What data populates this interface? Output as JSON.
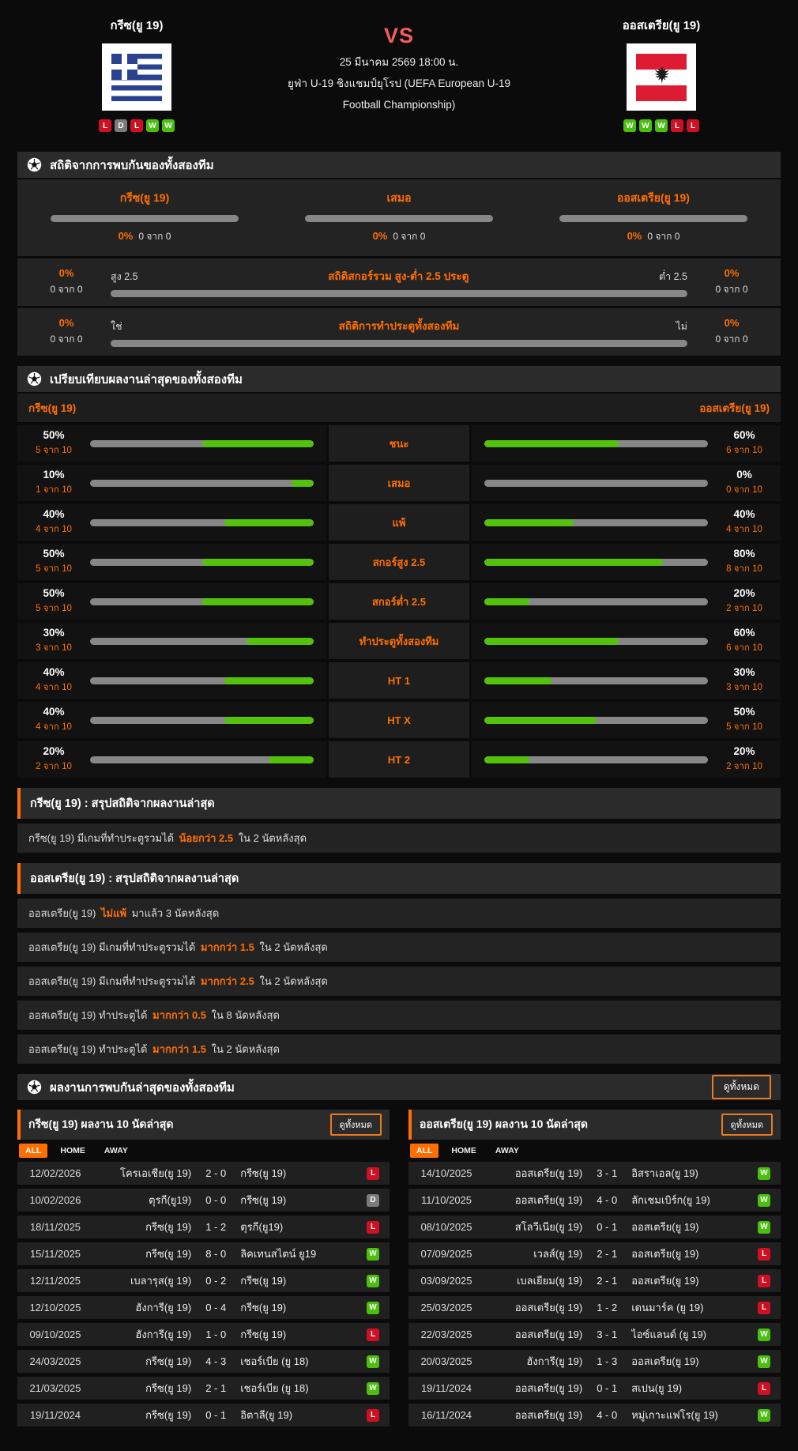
{
  "colors": {
    "accent": "#ff6f00",
    "bar_green": "#54c20d",
    "bar_gray": "#878787",
    "win": "#49c00d",
    "loss": "#d01022",
    "draw": "#7b7b7b",
    "vs_red": "#f65c5c"
  },
  "header": {
    "home_name": "กรีซ(ยู 19)",
    "away_name": "ออสเตรีย(ยู 19)",
    "vs_label": "VS",
    "kickoff": "25 มีนาคม 2569 18:00 น.",
    "competition_line1": "ยูฟ่า U-19 ชิงแชมป์ยุโรป (UEFA European U-19",
    "competition_line2": "Football Championship)",
    "home_form": [
      "L",
      "D",
      "L",
      "W",
      "W"
    ],
    "away_form": [
      "W",
      "W",
      "W",
      "L",
      "L"
    ]
  },
  "h2h": {
    "title": "สถิติจากการพบกันของทั้งสองทีม",
    "columns": [
      {
        "label": "กรีซ(ยู 19)",
        "pct_label": "0%",
        "count": "0 จาก 0",
        "pct": 0
      },
      {
        "label": "เสมอ",
        "pct_label": "0%",
        "count": "0 จาก 0",
        "pct": 0
      },
      {
        "label": "ออสเตรีย(ยู 19)",
        "pct_label": "0%",
        "count": "0 จาก 0",
        "pct": 0
      }
    ],
    "bar_rows": [
      {
        "left_pct_label": "0%",
        "left_count": "0 จาก 0",
        "bar_left_label": "สูง 2.5",
        "title": "สถิติสกอร์รวม สูง-ต่ำ 2.5 ประตู",
        "bar_right_label": "ต่ำ 2.5",
        "right_pct_label": "0%",
        "right_count": "0 จาก 0",
        "left_pct": 0,
        "right_pct": 0
      },
      {
        "left_pct_label": "0%",
        "left_count": "0 จาก 0",
        "bar_left_label": "ใช่",
        "title": "สถิติการทำประตูทั้งสองทีม",
        "bar_right_label": "ไม่",
        "right_pct_label": "0%",
        "right_count": "0 จาก 0",
        "left_pct": 0,
        "right_pct": 0
      }
    ]
  },
  "comparison": {
    "title": "เปรียบเทียบผลงานล่าสุดของทั้งสองทีม",
    "home_label": "กรีซ(ยู 19)",
    "away_label": "ออสเตรีย(ยู 19)",
    "rows": [
      {
        "label": "ชนะ",
        "home_pct": 50,
        "home_pct_label": "50%",
        "home_count": "5 จาก 10",
        "away_pct": 60,
        "away_pct_label": "60%",
        "away_count": "6 จาก 10"
      },
      {
        "label": "เสมอ",
        "home_pct": 10,
        "home_pct_label": "10%",
        "home_count": "1 จาก 10",
        "away_pct": 0,
        "away_pct_label": "0%",
        "away_count": "0 จาก 10"
      },
      {
        "label": "แพ้",
        "home_pct": 40,
        "home_pct_label": "40%",
        "home_count": "4 จาก 10",
        "away_pct": 40,
        "away_pct_label": "40%",
        "away_count": "4 จาก 10"
      },
      {
        "label": "สกอร์สูง 2.5",
        "home_pct": 50,
        "home_pct_label": "50%",
        "home_count": "5 จาก 10",
        "away_pct": 80,
        "away_pct_label": "80%",
        "away_count": "8 จาก 10"
      },
      {
        "label": "สกอร์ต่ำ 2.5",
        "home_pct": 50,
        "home_pct_label": "50%",
        "home_count": "5 จาก 10",
        "away_pct": 20,
        "away_pct_label": "20%",
        "away_count": "2 จาก 10"
      },
      {
        "label": "ทำประตูทั้งสองทีม",
        "home_pct": 30,
        "home_pct_label": "30%",
        "home_count": "3 จาก 10",
        "away_pct": 60,
        "away_pct_label": "60%",
        "away_count": "6 จาก 10"
      },
      {
        "label": "HT 1",
        "home_pct": 40,
        "home_pct_label": "40%",
        "home_count": "4 จาก 10",
        "away_pct": 30,
        "away_pct_label": "30%",
        "away_count": "3 จาก 10"
      },
      {
        "label": "HT X",
        "home_pct": 40,
        "home_pct_label": "40%",
        "home_count": "4 จาก 10",
        "away_pct": 50,
        "away_pct_label": "50%",
        "away_count": "5 จาก 10"
      },
      {
        "label": "HT 2",
        "home_pct": 20,
        "home_pct_label": "20%",
        "home_count": "2 จาก 10",
        "away_pct": 20,
        "away_pct_label": "20%",
        "away_count": "2 จาก 10"
      }
    ]
  },
  "home_summary": {
    "title": "กรีซ(ยู 19) : สรุปสถิติจากผลงานล่าสุด",
    "rows": [
      {
        "prefix": "กรีซ(ยู 19) มีเกมที่ทำประตูรวมได้",
        "highlight": "น้อยกว่า 2.5",
        "suffix": "ใน 2 นัดหลังสุด"
      }
    ]
  },
  "away_summary": {
    "title": "ออสเตรีย(ยู 19) : สรุปสถิติจากผลงานล่าสุด",
    "rows": [
      {
        "prefix": "ออสเตรีย(ยู 19)",
        "highlight": "ไม่แพ้",
        "suffix": "มาแล้ว 3 นัดหลังสุด"
      },
      {
        "prefix": "ออสเตรีย(ยู 19) มีเกมที่ทำประตูรวมได้",
        "highlight": "มากกว่า 1.5",
        "suffix": "ใน 2 นัดหลังสุด"
      },
      {
        "prefix": "ออสเตรีย(ยู 19) มีเกมที่ทำประตูรวมได้",
        "highlight": "มากกว่า 2.5",
        "suffix": "ใน 2 นัดหลังสุด"
      },
      {
        "prefix": "ออสเตรีย(ยู 19) ทำประตูได้",
        "highlight": "มากกว่า 0.5",
        "suffix": "ใน 8 นัดหลังสุด"
      },
      {
        "prefix": "ออสเตรีย(ยู 19) ทำประตูได้",
        "highlight": "มากกว่า 1.5",
        "suffix": "ใน 2 นัดหลังสุด"
      }
    ]
  },
  "meetings": {
    "title": "ผลงานการพบกันล่าสุดของทั้งสองทีม",
    "view_all": "ดูทั้งหมด"
  },
  "tables": {
    "view_all": "ดูทั้งหมด",
    "tabs": [
      "ALL",
      "HOME",
      "AWAY"
    ],
    "home": {
      "title": "กรีซ(ยู 19) ผลงาน 10 นัดล่าสุด",
      "matches": [
        {
          "date": "12/02/2026",
          "home": "โครเอเชีย(ยู 19)",
          "score": "2 - 0",
          "away": "กรีซ(ยู 19)",
          "result": "L"
        },
        {
          "date": "10/02/2026",
          "home": "ตุรกี(ยู19)",
          "score": "0 - 0",
          "away": "กรีซ(ยู 19)",
          "result": "D"
        },
        {
          "date": "18/11/2025",
          "home": "กรีซ(ยู 19)",
          "score": "1 - 2",
          "away": "ตุรกี(ยู19)",
          "result": "L"
        },
        {
          "date": "15/11/2025",
          "home": "กรีซ(ยู 19)",
          "score": "8 - 0",
          "away": "ลิคเทนสไตน์ ยู19",
          "result": "W"
        },
        {
          "date": "12/11/2025",
          "home": "เบลารุส(ยู 19)",
          "score": "0 - 2",
          "away": "กรีซ(ยู 19)",
          "result": "W"
        },
        {
          "date": "12/10/2025",
          "home": "ฮังการี(ยู 19)",
          "score": "0 - 4",
          "away": "กรีซ(ยู 19)",
          "result": "W"
        },
        {
          "date": "09/10/2025",
          "home": "ฮังการี(ยู 19)",
          "score": "1 - 0",
          "away": "กรีซ(ยู 19)",
          "result": "L"
        },
        {
          "date": "24/03/2025",
          "home": "กรีซ(ยู 19)",
          "score": "4 - 3",
          "away": "เชอร์เบีย (ยู 18)",
          "result": "W"
        },
        {
          "date": "21/03/2025",
          "home": "กรีซ(ยู 19)",
          "score": "2 - 1",
          "away": "เชอร์เบีย (ยู 18)",
          "result": "W"
        },
        {
          "date": "19/11/2024",
          "home": "กรีซ(ยู 19)",
          "score": "0 - 1",
          "away": "อิตาลี(ยู 19)",
          "result": "L"
        }
      ]
    },
    "away": {
      "title": "ออสเตรีย(ยู 19) ผลงาน 10 นัดล่าสุด",
      "matches": [
        {
          "date": "14/10/2025",
          "home": "ออสเตรีย(ยู 19)",
          "score": "3 - 1",
          "away": "อิสราเอล(ยู 19)",
          "result": "W"
        },
        {
          "date": "11/10/2025",
          "home": "ออสเตรีย(ยู 19)",
          "score": "4 - 0",
          "away": "ลักเชมเบิร์ก(ยู 19)",
          "result": "W"
        },
        {
          "date": "08/10/2025",
          "home": "สโลวีเนีย(ยู 19)",
          "score": "0 - 1",
          "away": "ออสเตรีย(ยู 19)",
          "result": "W"
        },
        {
          "date": "07/09/2025",
          "home": "เวลส์(ยู 19)",
          "score": "2 - 1",
          "away": "ออสเตรีย(ยู 19)",
          "result": "L"
        },
        {
          "date": "03/09/2025",
          "home": "เบลเยียม(ยู 19)",
          "score": "2 - 1",
          "away": "ออสเตรีย(ยู 19)",
          "result": "L"
        },
        {
          "date": "25/03/2025",
          "home": "ออสเตรีย(ยู 19)",
          "score": "1 - 2",
          "away": "เดนมาร์ค (ยู 19)",
          "result": "L"
        },
        {
          "date": "22/03/2025",
          "home": "ออสเตรีย(ยู 19)",
          "score": "3 - 1",
          "away": "ไอซ์แลนด์ (ยู 19)",
          "result": "W"
        },
        {
          "date": "20/03/2025",
          "home": "ฮังการี(ยู 19)",
          "score": "1 - 3",
          "away": "ออสเตรีย(ยู 19)",
          "result": "W"
        },
        {
          "date": "19/11/2024",
          "home": "ออสเตรีย(ยู 19)",
          "score": "0 - 1",
          "away": "สเปน(ยู 19)",
          "result": "L"
        },
        {
          "date": "16/11/2024",
          "home": "ออสเตรีย(ยู 19)",
          "score": "4 - 0",
          "away": "หมู่เกาะแฟโร(ยู 19)",
          "result": "W"
        }
      ]
    }
  }
}
